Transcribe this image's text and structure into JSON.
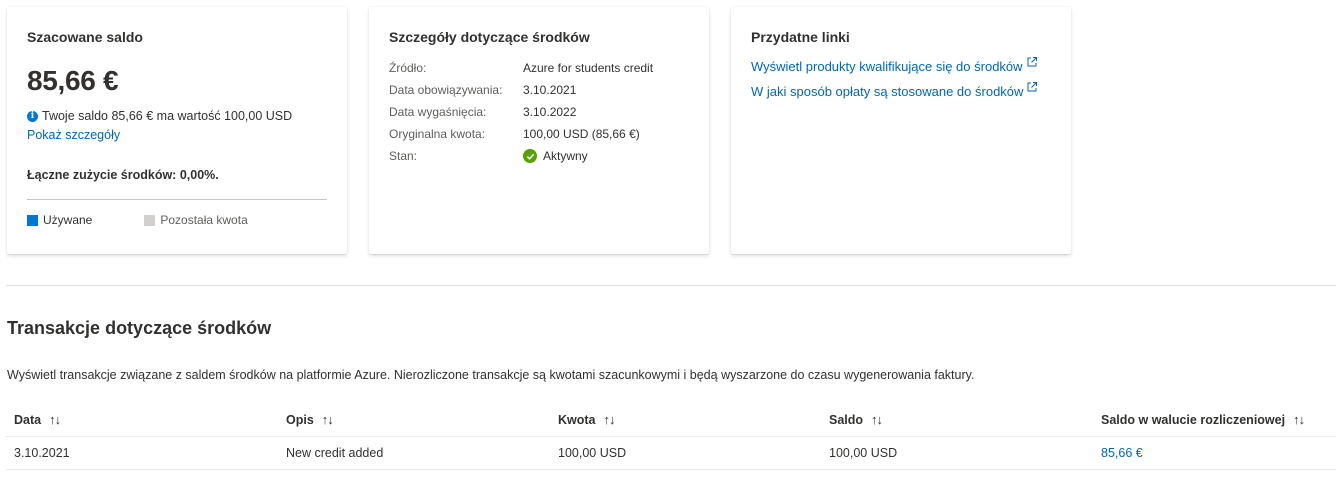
{
  "balance_card": {
    "title": "Szacowane saldo",
    "amount": "85,66 €",
    "info_icon": "info-icon",
    "info_text": "Twoje saldo 85,66 € ma wartość 100,00 USD",
    "show_details": "Pokaż szczegóły",
    "usage_text": "Łączne zużycie środków: 0,00%.",
    "legend": [
      {
        "label": "Używane",
        "color": "#0078d4"
      },
      {
        "label": "Pozostała kwota",
        "color": "#d2d0ce"
      }
    ]
  },
  "details_card": {
    "title": "Szczegóły dotyczące środków",
    "rows": [
      {
        "label": "Źródło:",
        "value": "Azure for students credit"
      },
      {
        "label": "Data obowiązywania:",
        "value": "3.10.2021"
      },
      {
        "label": "Data wygaśnięcia:",
        "value": "3.10.2022"
      },
      {
        "label": "Oryginalna kwota:",
        "value": "100,00 USD (85,66 €)"
      },
      {
        "label": "Stan:",
        "value": "Aktywny"
      }
    ],
    "status_icon": "checkmark-circle-icon",
    "status_color": "#57a300"
  },
  "links_card": {
    "title": "Przydatne linki",
    "links": [
      {
        "label": "Wyświetl produkty kwalifikujące się do środków"
      },
      {
        "label": "W jaki sposób opłaty są stosowane do środków"
      }
    ],
    "link_icon": "external-link-icon"
  },
  "transactions": {
    "title": "Transakcje dotyczące środków",
    "description": "Wyświetl transakcje związane z saldem środków na platformie Azure. Nierozliczone transakcje są kwotami szacunkowymi i będą wyszarzone do czasu wygenerowania faktury.",
    "columns": [
      "Data",
      "Opis",
      "Kwota",
      "Saldo",
      "Saldo w walucie rozliczeniowej"
    ],
    "sort_icon": "↑↓",
    "rows": [
      [
        "3.10.2021",
        "New credit added",
        "100,00 USD",
        "100,00 USD",
        "85,66 €"
      ]
    ]
  },
  "colors": {
    "accent": "#0078d4",
    "link": "#0067b8"
  }
}
